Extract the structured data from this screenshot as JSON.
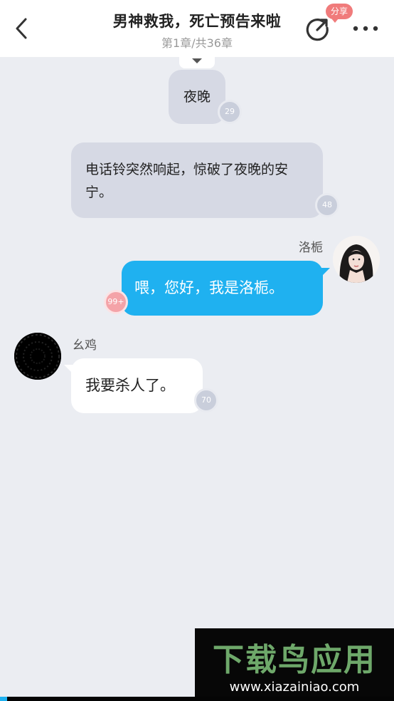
{
  "header": {
    "title": "男神救我，死亡预告来啦",
    "subtitle": "第1章/共36章",
    "share_badge": "分享",
    "back_icon": "chevron-left-icon",
    "share_icon": "share-icon",
    "more_icon": "more-icon"
  },
  "messages": [
    {
      "type": "narration",
      "text": "夜晚",
      "count": "29"
    },
    {
      "type": "narration",
      "text": "电话铃突然响起，惊破了夜晚的安宁。",
      "count": "48"
    },
    {
      "type": "right",
      "sender": "洛栀",
      "text": "喂，您好，我是洛栀。",
      "count": "99+"
    },
    {
      "type": "left",
      "sender": "幺鸡",
      "text": "我要杀人了。",
      "count": "70"
    }
  ],
  "watermark": {
    "logo": "下载鸟应用",
    "url": "www.xiazainiao.com"
  },
  "colors": {
    "background": "#ebedf2",
    "narration_bubble": "#d6d9e4",
    "right_bubble": "#1fb1f0",
    "left_bubble": "#ffffff",
    "share_badge": "#f07b7b",
    "pink_count": "#f4a3a8",
    "grey_count": "#c9cedb"
  }
}
